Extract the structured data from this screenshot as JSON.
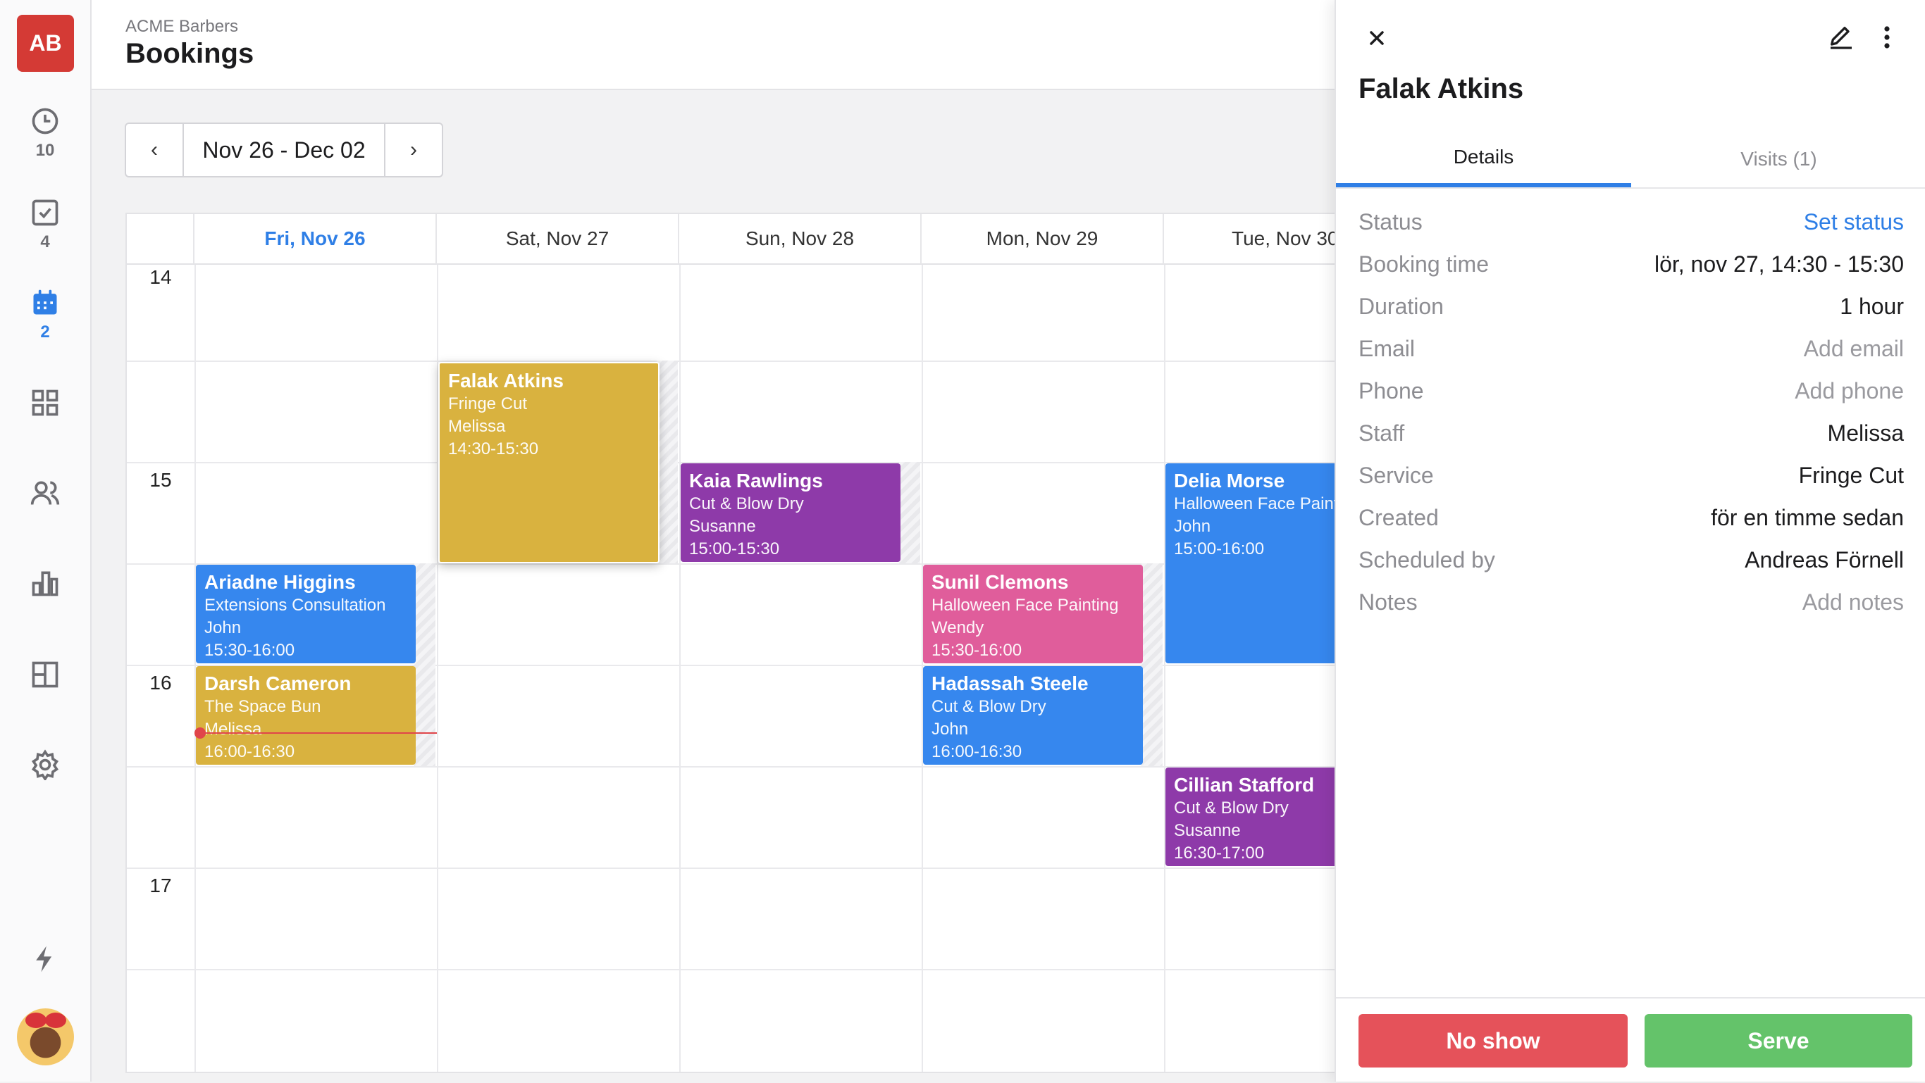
{
  "sidebar": {
    "logo": "AB",
    "items": [
      {
        "icon": "clock-icon",
        "count": "10"
      },
      {
        "icon": "checkbox-icon",
        "count": "4"
      },
      {
        "icon": "calendar-icon",
        "count": "2"
      },
      {
        "icon": "apps-grid-icon"
      },
      {
        "icon": "users-icon"
      },
      {
        "icon": "bar-chart-icon"
      },
      {
        "icon": "layout-icon"
      },
      {
        "icon": "gear-icon"
      },
      {
        "icon": "lightning-icon"
      }
    ]
  },
  "header": {
    "org": "ACME Barbers",
    "title": "Bookings"
  },
  "datenav": {
    "prev": "‹",
    "range": "Nov 26 - Dec 02",
    "next": "›"
  },
  "calendar": {
    "days": [
      "Fri, Nov 26",
      "Sat, Nov 27",
      "Sun, Nov 28",
      "Mon, Nov 29",
      "Tue, Nov 30"
    ],
    "hours": [
      "14",
      "15",
      "16",
      "17"
    ],
    "events": [
      {
        "name": "Falak Atkins",
        "service": "Fringe Cut",
        "staff": "Melissa",
        "time": "14:30-15:30",
        "color": "#d9b23f"
      },
      {
        "name": "Kaia Rawlings",
        "service": "Cut & Blow Dry",
        "staff": "Susanne",
        "time": "15:00-15:30",
        "color": "#8e3aa9"
      },
      {
        "name": "Delia Morse",
        "service": "Halloween Face Painting",
        "staff": "John",
        "time": "15:00-16:00",
        "color": "#3687ee"
      },
      {
        "name": "Ariadne Higgins",
        "service": "Extensions Consultation",
        "staff": "John",
        "time": "15:30-16:00",
        "color": "#3687ee"
      },
      {
        "name": "Sunil Clemons",
        "service": "Halloween Face Painting",
        "staff": "Wendy",
        "time": "15:30-16:00",
        "color": "#e05d9b"
      },
      {
        "name": "Darsh Cameron",
        "service": "The Space Bun",
        "staff": "Melissa",
        "time": "16:00-16:30",
        "color": "#d9b23f"
      },
      {
        "name": "Hadassah Steele",
        "service": "Cut & Blow Dry",
        "staff": "John",
        "time": "16:00-16:30",
        "color": "#3687ee"
      },
      {
        "name": "Cillian Stafford",
        "service": "Cut & Blow Dry",
        "staff": "Susanne",
        "time": "16:30-17:00",
        "color": "#8e3aa9"
      }
    ]
  },
  "panel": {
    "title": "Falak Atkins",
    "tabs": [
      "Details",
      "Visits (1)"
    ],
    "details": [
      {
        "label": "Status",
        "value": "Set status"
      },
      {
        "label": "Booking time",
        "value": "lör, nov 27, 14:30 - 15:30"
      },
      {
        "label": "Duration",
        "value": "1 hour"
      },
      {
        "label": "Email",
        "value": "Add email"
      },
      {
        "label": "Phone",
        "value": "Add phone"
      },
      {
        "label": "Staff",
        "value": "Melissa"
      },
      {
        "label": "Service",
        "value": "Fringe Cut"
      },
      {
        "label": "Created",
        "value": "för en timme sedan"
      },
      {
        "label": "Scheduled by",
        "value": "Andreas Förnell"
      },
      {
        "label": "Notes",
        "value": "Add notes"
      }
    ],
    "buttons": {
      "no_show": "No show",
      "serve": "Serve"
    },
    "colors": {
      "no_show": "#e5525a",
      "serve": "#64c36a",
      "accent": "#2f7fe6"
    }
  }
}
